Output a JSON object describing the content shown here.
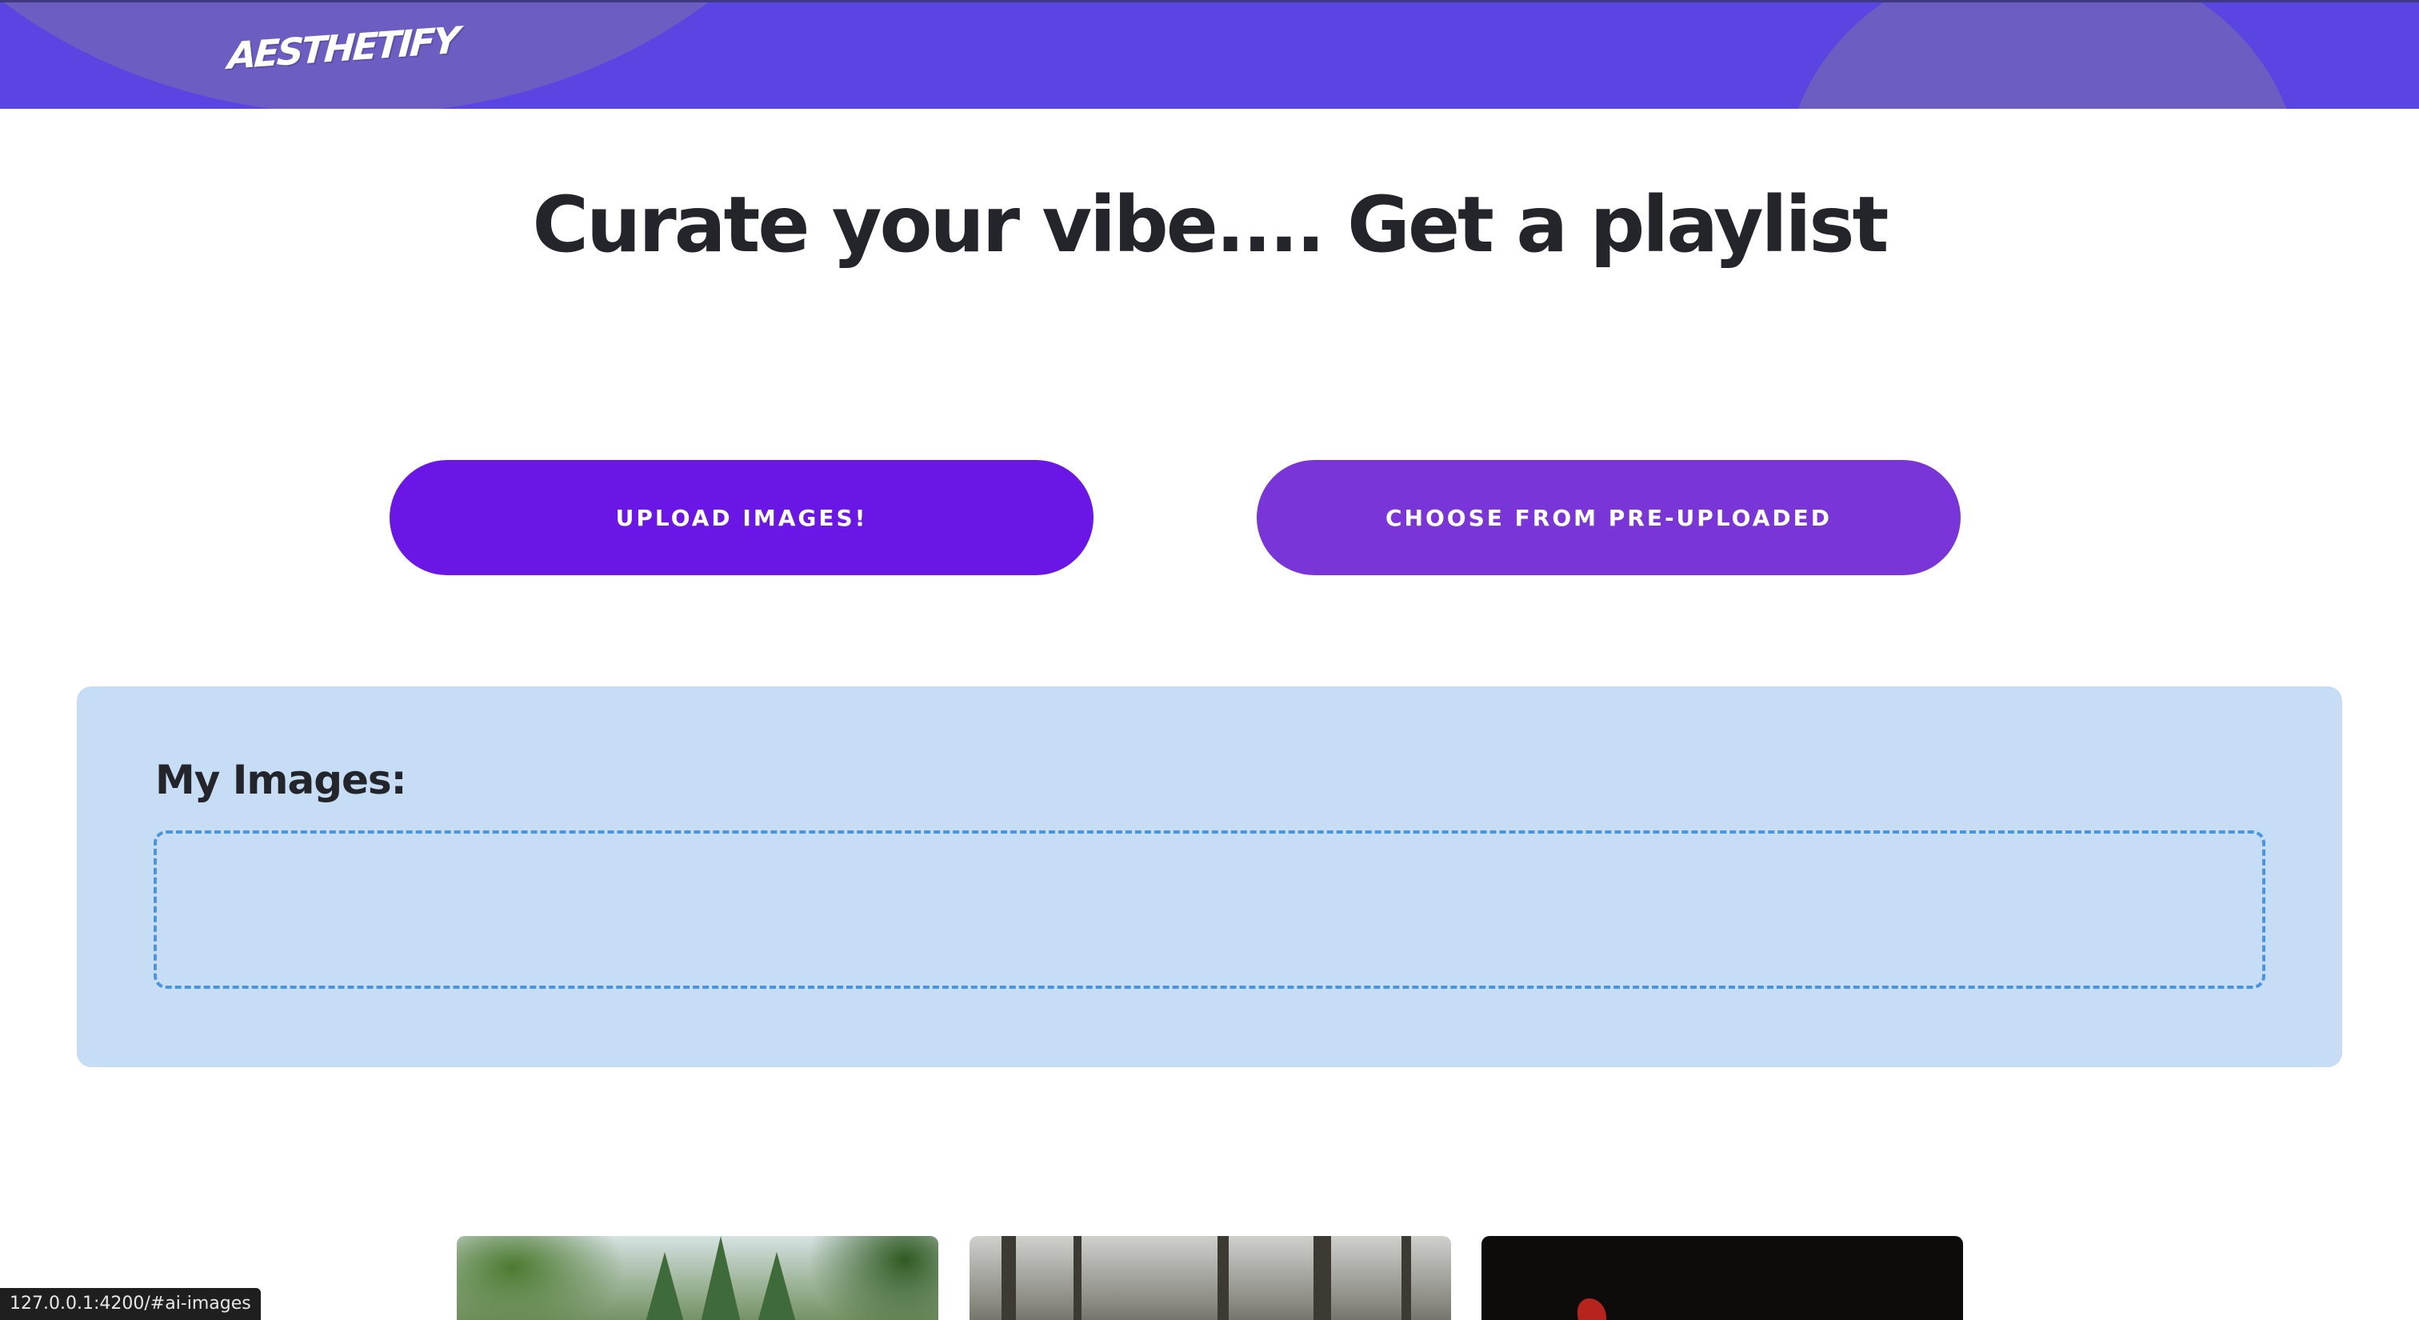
{
  "header": {
    "logo_text": "AESTHETIFY",
    "colors": {
      "background": "#5a45e2",
      "blob": "#6b5dc2"
    }
  },
  "main": {
    "title": "Curate your vibe.... Get a playlist",
    "buttons": {
      "upload_label": "UPLOAD IMAGES!",
      "choose_label": "CHOOSE FROM PRE-UPLOADED"
    },
    "colors": {
      "upload": "#6a16e6",
      "choose": "#7a35d8"
    }
  },
  "images_panel": {
    "heading": "My Images:",
    "colors": {
      "background": "#c7ddf5",
      "dropzone_border": "#4a95e0"
    }
  },
  "gallery": {
    "items": [
      {
        "icon": "forest-road-image"
      },
      {
        "icon": "misty-forest-image"
      },
      {
        "icon": "dark-red-image"
      }
    ]
  },
  "status_bar": {
    "url": "127.0.0.1:4200/#ai-images"
  }
}
